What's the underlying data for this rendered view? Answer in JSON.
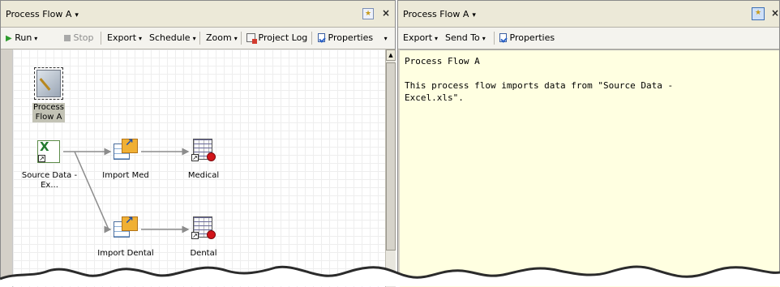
{
  "left_pane": {
    "title": "Process Flow A",
    "toolbar": {
      "run": "Run",
      "stop": "Stop",
      "export": "Export",
      "schedule": "Schedule",
      "zoom": "Zoom",
      "project_log": "Project Log",
      "properties": "Properties"
    },
    "nodes": {
      "process_flow": "Process Flow A",
      "source": "Source Data - Ex...",
      "import_med": "Import Med",
      "medical": "Medical",
      "import_dental": "Import Dental",
      "dental": "Dental"
    }
  },
  "right_pane": {
    "title": "Process Flow A",
    "toolbar": {
      "export": "Export",
      "send_to": "Send To",
      "properties": "Properties"
    },
    "notes_text": "Process Flow A\n\nThis process flow imports data from \"Source Data -\nExcel.xls\"."
  },
  "icons": {
    "close": "×",
    "dropdown": "▾"
  },
  "colors": {
    "notes_background": "#ffffe1",
    "run_green": "#2d9b2d",
    "dataset_red": "#d2141a"
  }
}
